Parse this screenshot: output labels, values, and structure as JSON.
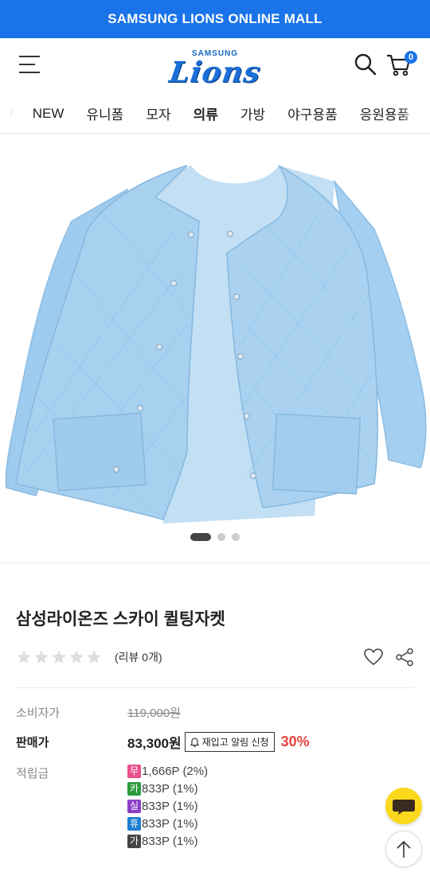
{
  "banner": {
    "text": "SAMSUNG LIONS ONLINE MALL",
    "color": "#1a73e8"
  },
  "header": {
    "logo_small": "SAMSUNG",
    "logo_big": "Lions",
    "cart_count": "0",
    "icons": [
      "menu-icon",
      "search-icon",
      "cart-icon"
    ]
  },
  "nav": {
    "partial": "!",
    "items": [
      "NEW",
      "유니폼",
      "모자",
      "의류",
      "가방",
      "야구용품",
      "응원용품"
    ],
    "active": "의류"
  },
  "gallery": {
    "slides": 3,
    "current": 1,
    "product_color": "#a8d0ef"
  },
  "product": {
    "title": "삼성라이온즈 스카이 퀼팅자켓",
    "review_text": "(리뷰 0개)",
    "rating": 0,
    "labels": {
      "consumer": "소비자가",
      "sale": "판매가",
      "points": "적립금"
    },
    "consumer_price": "119,000원",
    "sale_price": "83,300원",
    "alert_button": "재입고 알림 신청",
    "discount": "30%",
    "points": [
      {
        "badge": "무",
        "color": "#e8508c",
        "text": "1,666P (2%)"
      },
      {
        "badge": "카",
        "color": "#2e9a3e",
        "text": "833P (1%)"
      },
      {
        "badge": "실",
        "color": "#8a3fc6",
        "text": "833P (1%)"
      },
      {
        "badge": "휴",
        "color": "#1d7fd0",
        "text": "833P (1%)"
      },
      {
        "badge": "가",
        "color": "#444444",
        "text": "833P (1%)"
      }
    ]
  },
  "floating": {
    "chat_color": "#fbd81c"
  }
}
